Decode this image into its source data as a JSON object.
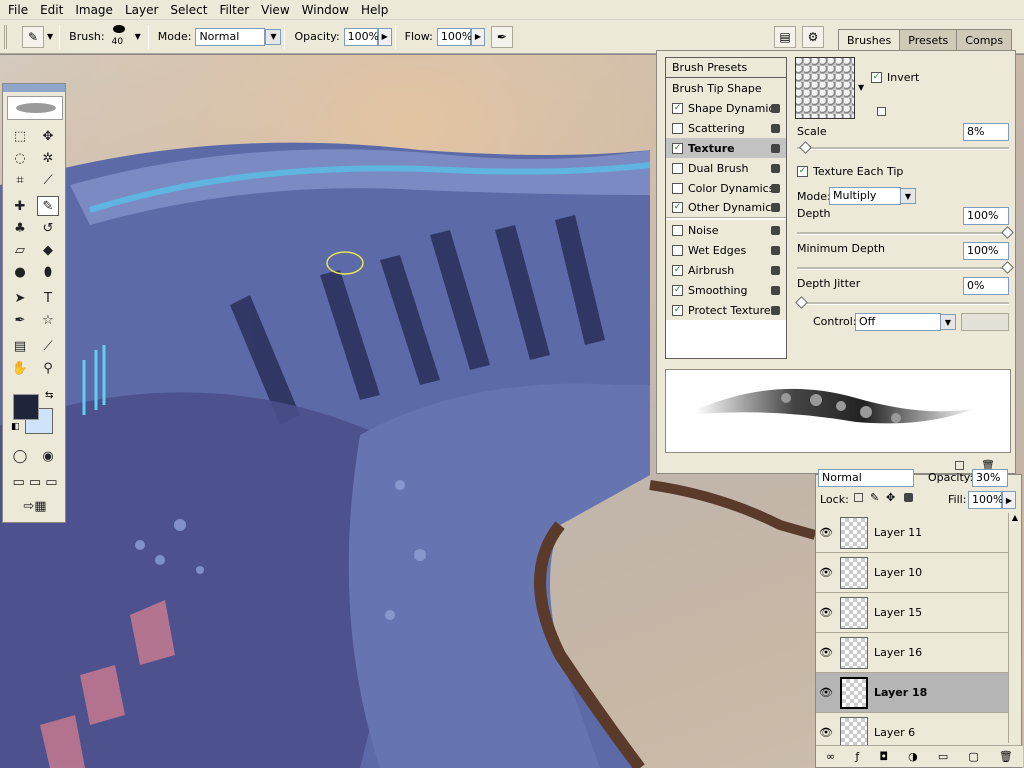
{
  "menu": [
    "File",
    "Edit",
    "Image",
    "Layer",
    "Select",
    "Filter",
    "View",
    "Window",
    "Help"
  ],
  "options": {
    "brush_label": "Brush:",
    "brush_size": "40",
    "mode_label": "Mode:",
    "mode_value": "Normal",
    "opacity_label": "Opacity:",
    "opacity_value": "100%",
    "flow_label": "Flow:",
    "flow_value": "100%"
  },
  "panel_tabs": [
    "Brushes",
    "Presets",
    "Comps"
  ],
  "brush_list": {
    "presets": "Brush Presets",
    "tip_shape": "Brush Tip Shape",
    "items": [
      {
        "label": "Shape Dynamics",
        "checked": "✓"
      },
      {
        "label": "Scattering",
        "checked": ""
      },
      {
        "label": "Texture",
        "checked": "✓"
      },
      {
        "label": "Dual Brush",
        "checked": ""
      },
      {
        "label": "Color Dynamics",
        "checked": ""
      },
      {
        "label": "Other Dynamics",
        "checked": "✓"
      },
      {
        "label": "Noise",
        "checked": ""
      },
      {
        "label": "Wet Edges",
        "checked": ""
      },
      {
        "label": "Airbrush",
        "checked": "✓"
      },
      {
        "label": "Smoothing",
        "checked": "✓"
      },
      {
        "label": "Protect Texture",
        "checked": "✓"
      }
    ]
  },
  "texture": {
    "invert_label": "Invert",
    "scale_label": "Scale",
    "scale_value": "8%",
    "each_tip_label": "Texture Each Tip",
    "mode_label": "Mode:",
    "mode_value": "Multiply",
    "depth_label": "Depth",
    "depth_value": "100%",
    "min_depth_label": "Minimum Depth",
    "min_depth_value": "100%",
    "depth_jitter_label": "Depth Jitter",
    "depth_jitter_value": "0%",
    "control_label": "Control:",
    "control_value": "Off"
  },
  "layers_panel": {
    "blend_mode": "Normal",
    "opacity_label": "Opacity:",
    "opacity_value": "30%",
    "lock_label": "Lock:",
    "fill_label": "Fill:",
    "fill_value": "100%",
    "layers": [
      "Layer 11",
      "Layer 10",
      "Layer 15",
      "Layer 16",
      "Layer 18",
      "Layer 6"
    ],
    "selected": "Layer 18"
  }
}
